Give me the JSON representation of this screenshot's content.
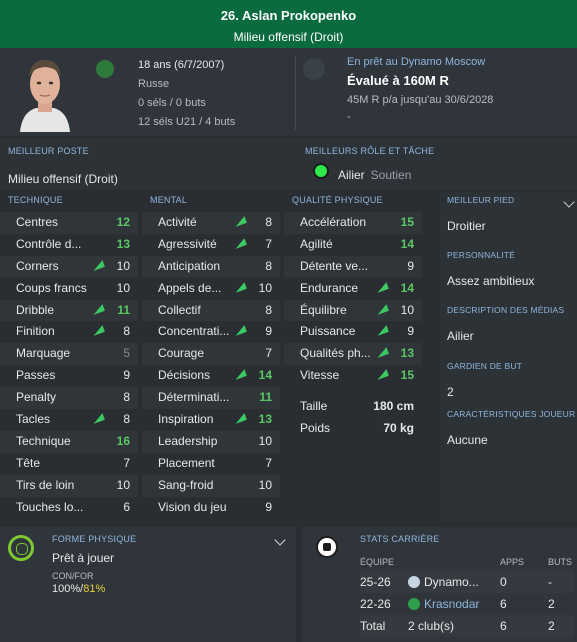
{
  "header": {
    "title": "26. Aslan Prokopenko",
    "position": "Milieu offensif (Droit)"
  },
  "info": {
    "age": "18 ans (6/7/2007)",
    "nationality": "Russe",
    "caps": "0 séls / 0 buts",
    "youth_caps": "12 séls U21 / 4 buts",
    "loan": "En prêt au Dynamo Moscow",
    "value": "Évalué à 160M R",
    "contract": "45M R p/a jusqu'au 30/6/2028",
    "extra": "-"
  },
  "best_position": {
    "label": "MEILLEUR POSTE",
    "value": "Milieu offensif (Droit)"
  },
  "best_role": {
    "label": "MEILLEURS RÔLE ET TÂCHE",
    "role": "Ailier",
    "duty": "Soutien"
  },
  "technique": {
    "label": "TECHNIQUE",
    "rows": [
      {
        "name": "Centres",
        "value": "12",
        "style": "green",
        "arrow": false
      },
      {
        "name": "Contrôle d...",
        "value": "13",
        "style": "green",
        "arrow": false
      },
      {
        "name": "Corners",
        "value": "10",
        "style": "white",
        "arrow": true
      },
      {
        "name": "Coups francs",
        "value": "10",
        "style": "white",
        "arrow": false
      },
      {
        "name": "Dribble",
        "value": "11",
        "style": "green",
        "arrow": true
      },
      {
        "name": "Finition",
        "value": "8",
        "style": "white",
        "arrow": true
      },
      {
        "name": "Marquage",
        "value": "5",
        "style": "grey",
        "arrow": false
      },
      {
        "name": "Passes",
        "value": "9",
        "style": "white",
        "arrow": false
      },
      {
        "name": "Penalty",
        "value": "8",
        "style": "white",
        "arrow": false
      },
      {
        "name": "Tacles",
        "value": "8",
        "style": "white",
        "arrow": true
      },
      {
        "name": "Technique",
        "value": "16",
        "style": "green",
        "arrow": false
      },
      {
        "name": "Tête",
        "value": "7",
        "style": "white",
        "arrow": false
      },
      {
        "name": "Tirs de loin",
        "value": "10",
        "style": "white",
        "arrow": false
      },
      {
        "name": "Touches lo...",
        "value": "6",
        "style": "white",
        "arrow": false
      }
    ]
  },
  "mental": {
    "label": "MENTAL",
    "rows": [
      {
        "name": "Activité",
        "value": "8",
        "style": "white",
        "arrow": true
      },
      {
        "name": "Agressivité",
        "value": "7",
        "style": "white",
        "arrow": true
      },
      {
        "name": "Anticipation",
        "value": "8",
        "style": "white",
        "arrow": false
      },
      {
        "name": "Appels de...",
        "value": "10",
        "style": "white",
        "arrow": true
      },
      {
        "name": "Collectif",
        "value": "8",
        "style": "white",
        "arrow": false
      },
      {
        "name": "Concentrati...",
        "value": "9",
        "style": "white",
        "arrow": true
      },
      {
        "name": "Courage",
        "value": "7",
        "style": "white",
        "arrow": false
      },
      {
        "name": "Décisions",
        "value": "14",
        "style": "green",
        "arrow": true
      },
      {
        "name": "Déterminati...",
        "value": "11",
        "style": "green",
        "arrow": false
      },
      {
        "name": "Inspiration",
        "value": "13",
        "style": "green",
        "arrow": true
      },
      {
        "name": "Leadership",
        "value": "10",
        "style": "white",
        "arrow": false
      },
      {
        "name": "Placement",
        "value": "7",
        "style": "white",
        "arrow": false
      },
      {
        "name": "Sang-froid",
        "value": "10",
        "style": "white",
        "arrow": false
      },
      {
        "name": "Vision du jeu",
        "value": "9",
        "style": "white",
        "arrow": false
      }
    ]
  },
  "physical": {
    "label": "QUALITÉ PHYSIQUE",
    "rows": [
      {
        "name": "Accélération",
        "value": "15",
        "style": "green",
        "arrow": false
      },
      {
        "name": "Agilité",
        "value": "14",
        "style": "green",
        "arrow": false
      },
      {
        "name": "Détente ve...",
        "value": "9",
        "style": "white",
        "arrow": false
      },
      {
        "name": "Endurance",
        "value": "14",
        "style": "green",
        "arrow": true
      },
      {
        "name": "Équilibre",
        "value": "10",
        "style": "white",
        "arrow": true
      },
      {
        "name": "Puissance",
        "value": "9",
        "style": "white",
        "arrow": true
      },
      {
        "name": "Qualités ph...",
        "value": "13",
        "style": "green",
        "arrow": true
      },
      {
        "name": "Vitesse",
        "value": "15",
        "style": "green",
        "arrow": true
      }
    ],
    "height_label": "Taille",
    "height": "180 cm",
    "weight_label": "Poids",
    "weight": "70 kg"
  },
  "side": {
    "foot_label": "MEILLEUR PIED",
    "foot": "Droitier",
    "personality_label": "PERSONNALITÉ",
    "personality": "Assez ambitieux",
    "media_label": "DESCRIPTION DES MÉDIAS",
    "media": "Ailier",
    "gk_label": "GARDIEN DE BUT",
    "gk": "2",
    "traits_label": "CARACTÉRISTIQUES JOUEUR",
    "traits": "Aucune"
  },
  "fitness": {
    "label": "FORME PHYSIQUE",
    "status": "Prêt à jouer",
    "confor_label": "CON/FOR",
    "con": "100%",
    "sep": "/",
    "form": "81%"
  },
  "career": {
    "label": "STATS CARRIÈRE",
    "headers": [
      "ÉQUIPE",
      "APPS",
      "BUTS"
    ],
    "rows": [
      {
        "season": "25-26",
        "team": "Dynamo...",
        "apps": "0",
        "goals": "-"
      },
      {
        "season": "22-26",
        "team": "Krasnodar",
        "apps": "6",
        "goals": "2"
      }
    ],
    "total": {
      "label": "Total",
      "clubs": "2 club(s)",
      "apps": "6",
      "goals": "2"
    }
  },
  "colors": {
    "header": "#0a6b3f",
    "accent_blue": "#8fb6dd",
    "green_value": "#5ac864",
    "role_dot": "#2ee84a",
    "form_yellow": "#e8d23c"
  }
}
